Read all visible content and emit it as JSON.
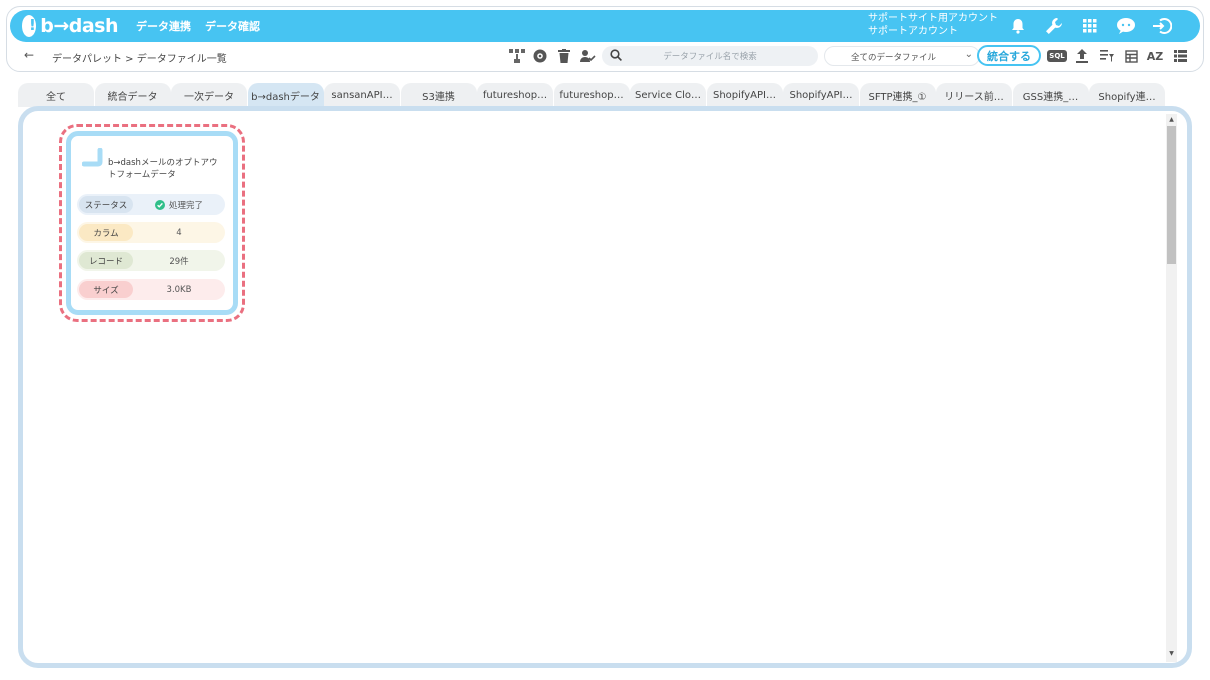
{
  "header": {
    "logo_text": "b→dash",
    "nav": [
      "データ連携",
      "データ確認"
    ],
    "account_line1": "サポートサイト用アカウント",
    "account_line2": "サポートアカウント"
  },
  "toolbar": {
    "breadcrumb": "データパレット > データファイル一覧",
    "search_placeholder": "データファイル名で検索",
    "filter_value": "全てのデータファイル",
    "merge_label": "統合する",
    "sql_label": "SQL",
    "sort_label": "AZ"
  },
  "tabs": [
    {
      "label": "全て"
    },
    {
      "label": "統合データ"
    },
    {
      "label": "一次データ"
    },
    {
      "label": "b→dashデータ"
    },
    {
      "label": "sansanAPI…"
    },
    {
      "label": "S3連携"
    },
    {
      "label": "futureshop…"
    },
    {
      "label": "futureshop…"
    },
    {
      "label": "Service Clo…"
    },
    {
      "label": "ShopifyAPI…"
    },
    {
      "label": "ShopifyAPI…"
    },
    {
      "label": "SFTP連携_①"
    },
    {
      "label": "リリース前…"
    },
    {
      "label": "GSS連携_…"
    },
    {
      "label": "Shopify連…"
    }
  ],
  "active_tab_index": 3,
  "card": {
    "title": "b→dashメールのオプトアウトフォームデータ",
    "rows": [
      {
        "label": "ステータス",
        "value": "処理完了"
      },
      {
        "label": "カラム",
        "value": "4"
      },
      {
        "label": "レコード",
        "value": "29件"
      },
      {
        "label": "サイズ",
        "value": "3.0KB"
      }
    ]
  },
  "colors": {
    "brand": "#47c4f2",
    "highlight": "#ea7080",
    "status_ok": "#2fbf8a"
  }
}
